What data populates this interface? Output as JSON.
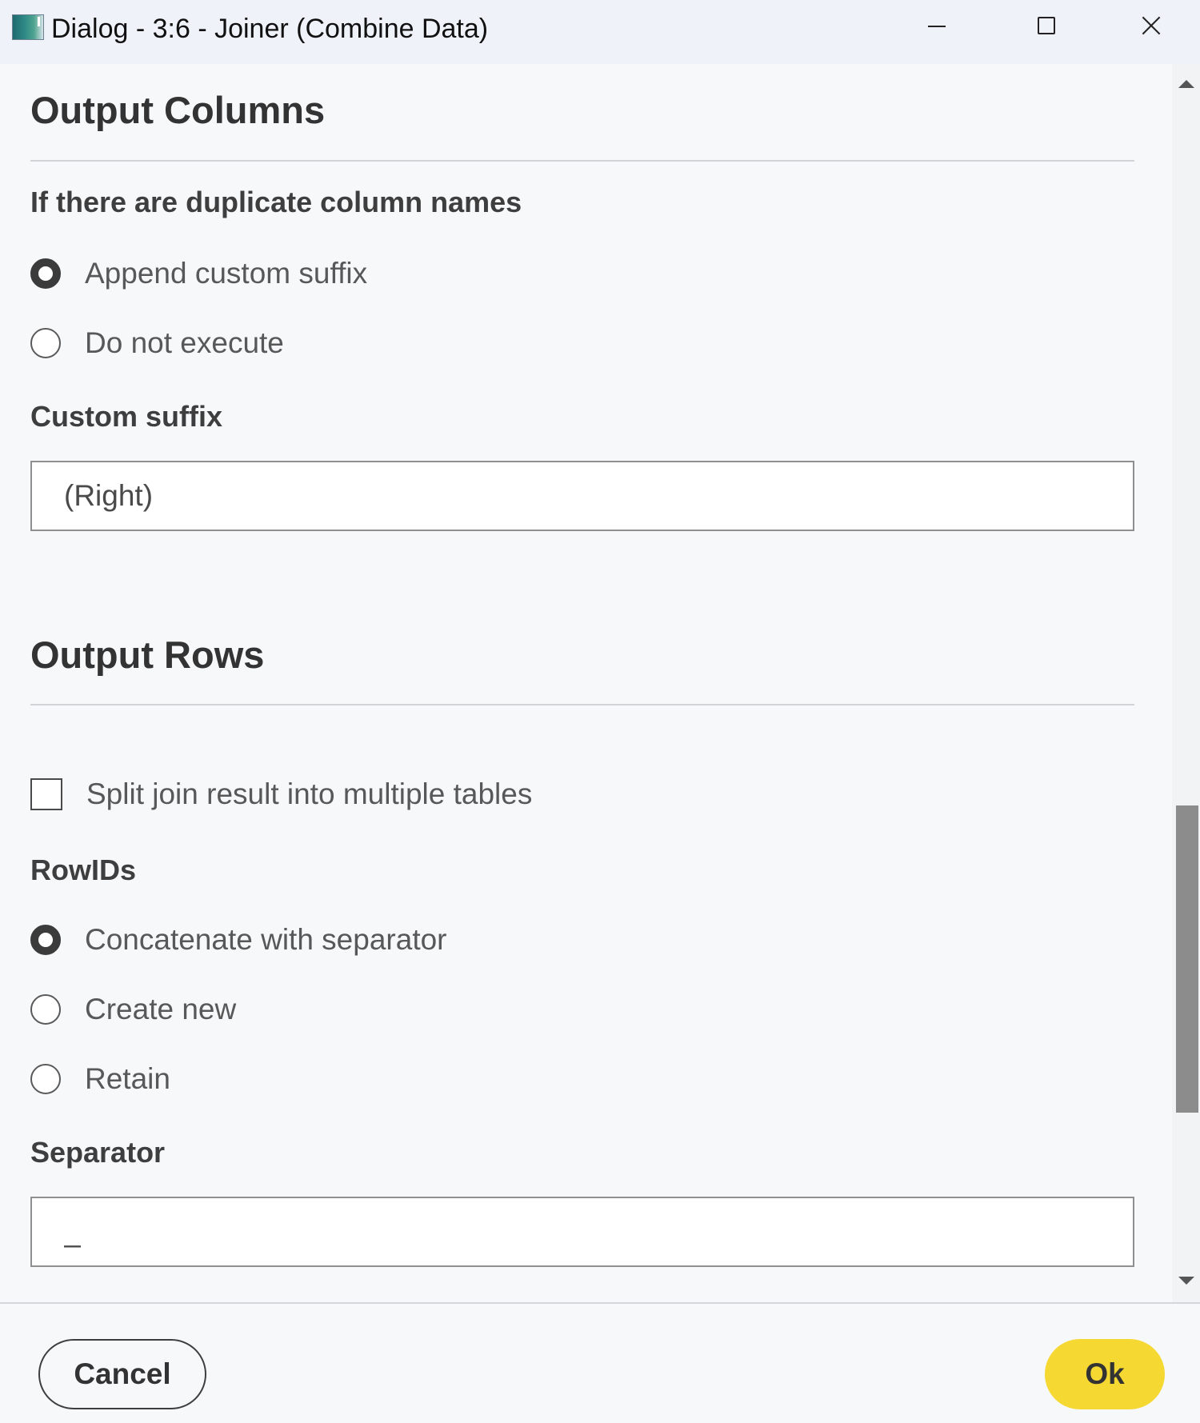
{
  "window": {
    "title": "Dialog - 3:6 - Joiner (Combine Data)",
    "icon": "app-icon"
  },
  "output_columns": {
    "title": "Output Columns",
    "duplicate_label": "If there are duplicate column names",
    "options": [
      {
        "label": "Append custom suffix",
        "checked": true
      },
      {
        "label": "Do not execute",
        "checked": false
      }
    ],
    "suffix_label": "Custom suffix",
    "suffix_value": "(Right)"
  },
  "output_rows": {
    "title": "Output Rows",
    "split_label": "Split join result into multiple tables",
    "split_checked": false,
    "rowids_label": "RowIDs",
    "rowid_options": [
      {
        "label": "Concatenate with separator",
        "checked": true
      },
      {
        "label": "Create new",
        "checked": false
      },
      {
        "label": "Retain",
        "checked": false
      }
    ],
    "separator_label": "Separator",
    "separator_value": "_"
  },
  "footer": {
    "cancel_label": "Cancel",
    "ok_label": "Ok",
    "ok_color": "#f5d832"
  }
}
